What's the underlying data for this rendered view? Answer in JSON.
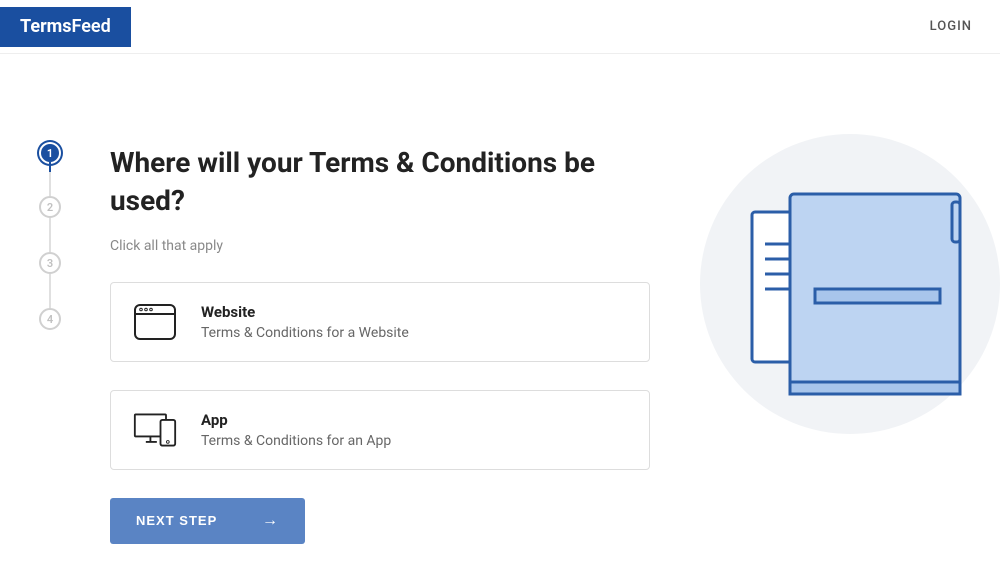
{
  "header": {
    "logo_part1": "Terms",
    "logo_part2": "Feed",
    "login": "LOGIN"
  },
  "stepper": {
    "steps": [
      "1",
      "2",
      "3",
      "4"
    ],
    "active_index": 0
  },
  "content": {
    "title": "Where will your Terms & Conditions be used?",
    "subtitle": "Click all that apply",
    "options": [
      {
        "title": "Website",
        "desc": "Terms & Conditions for a Website",
        "icon": "browser-icon"
      },
      {
        "title": "App",
        "desc": "Terms & Conditions for an App",
        "icon": "devices-icon"
      }
    ],
    "next_button": "NEXT STEP"
  }
}
